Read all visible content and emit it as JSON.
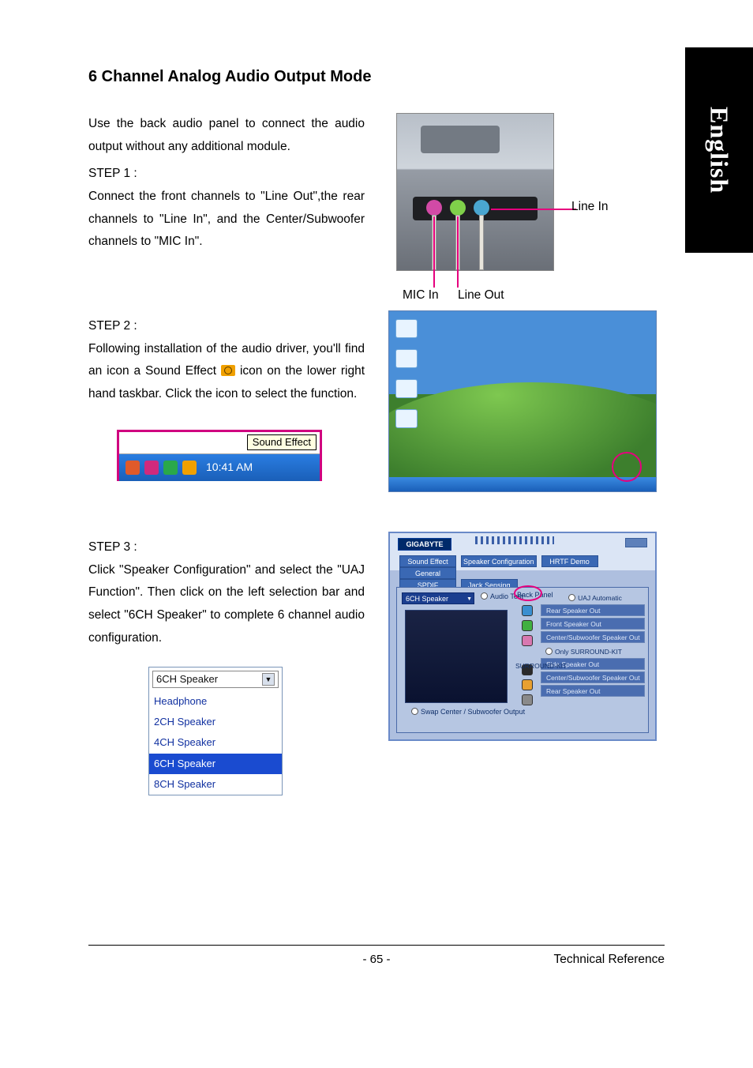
{
  "sideTab": "English",
  "title": "6 Channel Analog Audio Output Mode",
  "step1": {
    "intro": "Use the back audio panel to connect the audio output without any additional module.",
    "label": "STEP 1 :",
    "body": "Connect the front channels to \"Line Out\",the rear channels to \"Line In\", and the Center/Subwoofer channels to \"MIC In\".",
    "linein": "Line In",
    "micin": "MIC In",
    "lineout": "Line Out"
  },
  "step2": {
    "label": "STEP 2 :",
    "pre": "Following installation of the audio driver, you'll find an icon a Sound Effect ",
    "post": " icon on the lower right hand taskbar.  Click the icon to select the function.",
    "tooltip": "Sound Effect",
    "clock": "10:41 AM"
  },
  "step3": {
    "label": "STEP 3 :",
    "body": "Click \"Speaker Configuration\" and select the \"UAJ Function\".  Then click on the left selection bar and select \"6CH Speaker\" to complete 6 channel audio configuration.",
    "dropdown": {
      "selected": "6CH Speaker",
      "options": [
        "Headphone",
        "2CH Speaker",
        "4CH Speaker",
        "6CH Speaker",
        "8CH Speaker"
      ]
    },
    "panel": {
      "logo": "GIGABYTE",
      "tabs": [
        "Sound Effect",
        "Speaker Configuration",
        "HRTF Demo",
        "General"
      ],
      "tabs2": [
        "SPDIF",
        "Jack Sensing"
      ],
      "speakerSel": "6CH Speaker",
      "audioTest": "Audio Test",
      "backPanel": "Back Panel",
      "uaj": "UAJ Automatic",
      "jackLabels": [
        "Rear Speaker Out",
        "Front Speaker Out",
        "Center/Subwoofer Speaker Out"
      ],
      "surroundKit": "SURROUND-KIT",
      "onlySurround": "Only SURROUND-KIT",
      "surrLabels": [
        "Side Speaker Out",
        "Center/Subwoofer Speaker Out",
        "Rear Speaker Out"
      ],
      "swap": "Swap Center / Subwoofer Output"
    }
  },
  "footer": {
    "pageNum": "- 65 -",
    "section": "Technical Reference"
  }
}
